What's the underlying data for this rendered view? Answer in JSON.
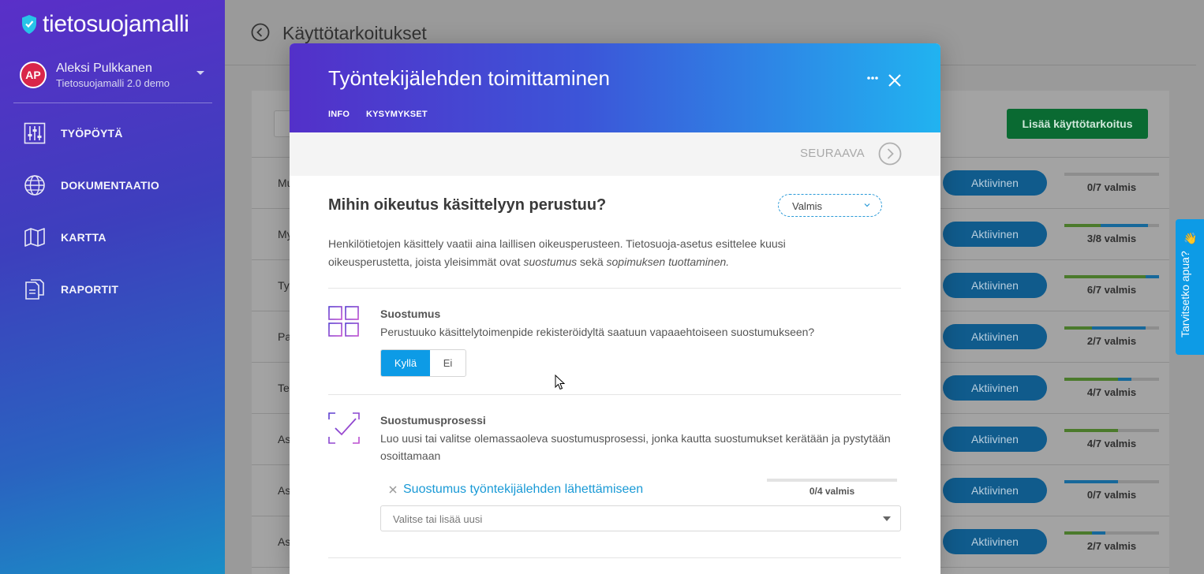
{
  "sidebar": {
    "logo_text": "tietosuojamalli",
    "user": {
      "initials": "AP",
      "name": "Aleksi Pulkkanen",
      "org": "Tietosuojamalli 2.0 demo"
    },
    "nav": [
      {
        "label": "TYÖPÖYTÄ",
        "icon": "sliders-icon"
      },
      {
        "label": "DOKUMENTAATIO",
        "icon": "globe-icon"
      },
      {
        "label": "KARTTA",
        "icon": "map-icon"
      },
      {
        "label": "RAPORTIT",
        "icon": "reports-icon"
      }
    ]
  },
  "page": {
    "title": "Käyttötarkoitukset",
    "add_button": "Lisää käyttötarkoitus",
    "rows": [
      {
        "name": "Mu",
        "status": "Aktiivinen",
        "count": "0/7 valmis",
        "green": 0,
        "blue": 0
      },
      {
        "name": "My",
        "status": "Aktiivinen",
        "count": "3/8 valmis",
        "green": 0.38,
        "blue": 0.88
      },
      {
        "name": "Ty",
        "status": "Aktiivinen",
        "count": "6/7 valmis",
        "green": 0.86,
        "blue": 1.0
      },
      {
        "name": "Pa",
        "status": "Aktiivinen",
        "count": "2/7 valmis",
        "green": 0.29,
        "blue": 0.86
      },
      {
        "name": "Te",
        "status": "Aktiivinen",
        "count": "4/7 valmis",
        "green": 0.57,
        "blue": 0.71
      },
      {
        "name": "As",
        "status": "Aktiivinen",
        "count": "4/7 valmis",
        "green": 0.57,
        "blue": 0.57
      },
      {
        "name": "As",
        "status": "Aktiivinen",
        "count": "0/7 valmis",
        "green": 0,
        "blue": 0.57
      },
      {
        "name": "As",
        "status": "Aktiivinen",
        "count": "2/7 valmis",
        "green": 0.29,
        "blue": 0.43
      }
    ]
  },
  "help_tab": {
    "label": "Tarvitsetko apua?",
    "emoji": "👋"
  },
  "modal": {
    "title": "Työntekijälehden toimittaminen",
    "tabs": [
      "INFO",
      "KYSYMYKSET"
    ],
    "next_label": "SEURAAVA",
    "question_title": "Mihin oikeutus käsittelyyn perustuu?",
    "status_value": "Valmis",
    "description_plain": "Henkilötietojen käsittely vaatii aina laillisen oikeusperusteen. Tietosuoja-asetus esittelee kuusi oikeusperustetta, joista yleisimmät ovat ",
    "description_em1": "suostumus",
    "description_mid": " sekä ",
    "description_em2": "sopimuksen tuottaminen.",
    "sections": [
      {
        "title": "Suostumus",
        "text": "Perustuuko käsittelytoimenpide rekisteröidyltä saatuun vapaaehtoiseen suostumukseen?",
        "yes": "Kyllä",
        "no": "Ei"
      },
      {
        "title": "Suostumusprosessi",
        "text": "Luo uusi tai valitse olemassaoleva suostumusprosessi, jonka kautta suostumukset kerätään ja pystytään osoittamaan",
        "linked_item": "Suostumus työntekijälehden lähettämiseen",
        "linked_count": "0/4 valmis",
        "picker_placeholder": "Valitse tai lisää uusi"
      }
    ]
  },
  "colors": {
    "accent_blue": "#0d9be6",
    "add_green": "#0a8a3e",
    "header_gradient_start": "#5330c9",
    "header_gradient_end": "#21b3f0"
  }
}
